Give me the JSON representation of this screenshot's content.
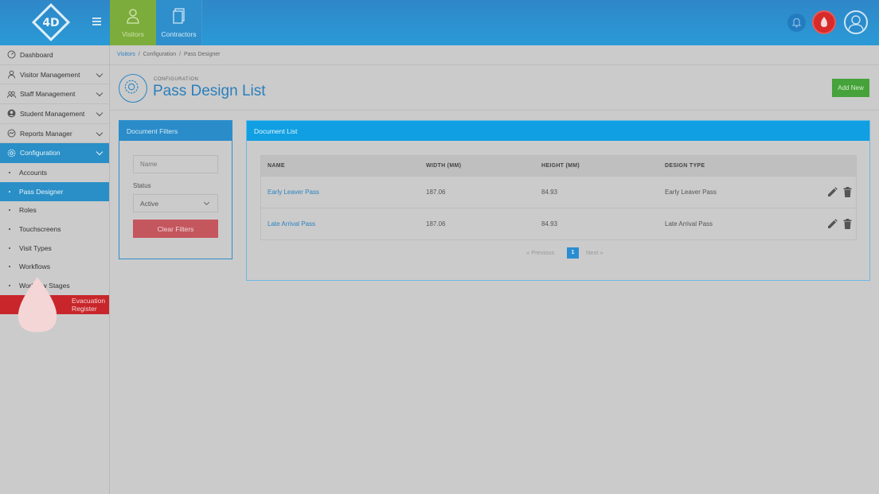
{
  "header": {
    "logo_text": "4D",
    "nav": [
      {
        "label": "Visitors",
        "icon": "person-icon"
      },
      {
        "label": "Contractors",
        "icon": "document-icon"
      }
    ]
  },
  "sidebar": {
    "items": [
      {
        "label": "Dashboard",
        "icon": "dashboard-icon"
      },
      {
        "label": "Visitor Management",
        "icon": "person-icon"
      },
      {
        "label": "Staff Management",
        "icon": "group-icon"
      },
      {
        "label": "Student Management",
        "icon": "student-icon"
      },
      {
        "label": "Reports Manager",
        "icon": "reports-icon"
      },
      {
        "label": "Configuration",
        "icon": "gear-icon"
      }
    ],
    "sub_items": [
      "Accounts",
      "Pass Designer",
      "Roles",
      "Touchscreens",
      "Visit Types",
      "Workflows",
      "Workflow Stages"
    ],
    "evacuation": "Evacuation Register"
  },
  "breadcrumb": {
    "root": "Visitors",
    "sep": "/",
    "mid": "Configuration",
    "current": "Pass Designer"
  },
  "page": {
    "eyebrow": "CONFIGURATION",
    "title": "Pass Design List",
    "add_new": "Add New"
  },
  "filters": {
    "title": "Document Filters",
    "name_placeholder": "Name",
    "status_label": "Status",
    "status_value": "Active",
    "clear_label": "Clear Filters"
  },
  "doclist": {
    "title": "Document List",
    "columns": [
      "NAME",
      "WIDTH (MM)",
      "HEIGHT (MM)",
      "DESIGN TYPE"
    ],
    "rows": [
      {
        "name": "Early Leaver Pass",
        "width": "187.06",
        "height": "84.93",
        "type": "Early Leaver Pass"
      },
      {
        "name": "Late Arrival Pass",
        "width": "187.06",
        "height": "84.93",
        "type": "Late Arrival Pass"
      }
    ],
    "pager": {
      "prev": "«   Previous",
      "page": "1",
      "next": "Next   »"
    }
  },
  "colors": {
    "primary": "#2a8fc6",
    "visitors_tab": "#7cac3c",
    "evacuation": "#c8262b",
    "add_new": "#46a23a"
  }
}
